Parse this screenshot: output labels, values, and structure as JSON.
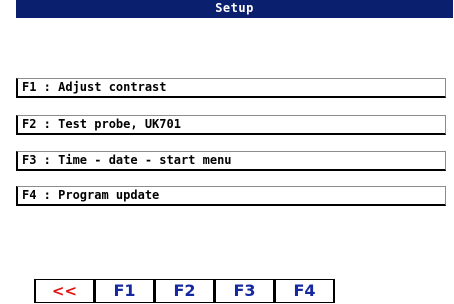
{
  "window": {
    "title": "Setup"
  },
  "menu": {
    "items": [
      {
        "key": "F1",
        "label": "F1 : Adjust contrast"
      },
      {
        "key": "F2",
        "label": "F2 : Test probe, UK701"
      },
      {
        "key": "F3",
        "label": "F3 : Time - date - start menu"
      },
      {
        "key": "F4",
        "label": "F4 : Program update"
      }
    ]
  },
  "function_keys": {
    "back": "<<",
    "f1": "F1",
    "f2": "F2",
    "f3": "F3",
    "f4": "F4"
  },
  "colors": {
    "title_bar": "#0a1f6e",
    "fkey_text": "#1428a0",
    "back_key_text": "#e01010"
  }
}
